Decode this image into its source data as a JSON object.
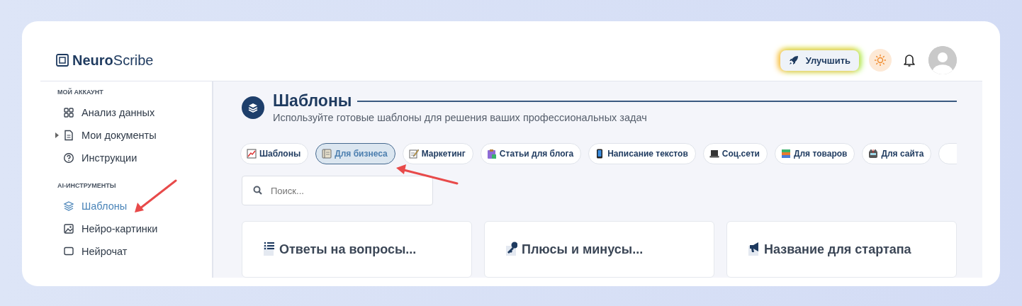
{
  "brand": {
    "bold": "Neuro",
    "light": "Scribe"
  },
  "header": {
    "upgrade": "Улучшить"
  },
  "sidebar": {
    "sections": [
      {
        "title": "МОЙ АККАУНТ",
        "items": [
          {
            "label": "Анализ данных",
            "kind": "link",
            "selected": false
          },
          {
            "label": "Мои документы",
            "kind": "group",
            "selected": false
          },
          {
            "label": "Инструкции",
            "kind": "link",
            "selected": false
          }
        ]
      },
      {
        "title": "AI-ИНСТРУМЕНТЫ",
        "items": [
          {
            "label": "Шаблоны",
            "kind": "link",
            "selected": true
          },
          {
            "label": "Нейро-картинки",
            "kind": "link",
            "selected": false
          },
          {
            "label": "Нейрочат",
            "kind": "link",
            "selected": false
          }
        ]
      }
    ]
  },
  "page": {
    "title": "Шаблоны",
    "subtitle": "Используйте готовые шаблоны для решения ваших профессиональных задач"
  },
  "chips": [
    {
      "label": "Шаблоны",
      "selected": false
    },
    {
      "label": "Для бизнеса",
      "selected": true
    },
    {
      "label": "Маркетинг",
      "selected": false
    },
    {
      "label": "Статьи для блога",
      "selected": false
    },
    {
      "label": "Написание текстов",
      "selected": false
    },
    {
      "label": "Соц.сети",
      "selected": false
    },
    {
      "label": "Для товаров",
      "selected": false
    },
    {
      "label": "Для сайта",
      "selected": false
    }
  ],
  "search": {
    "placeholder": "Поиск..."
  },
  "cards": [
    {
      "title": "Ответы на вопросы..."
    },
    {
      "title": "Плюсы и минусы..."
    },
    {
      "title": "Название для стартапа"
    }
  ]
}
